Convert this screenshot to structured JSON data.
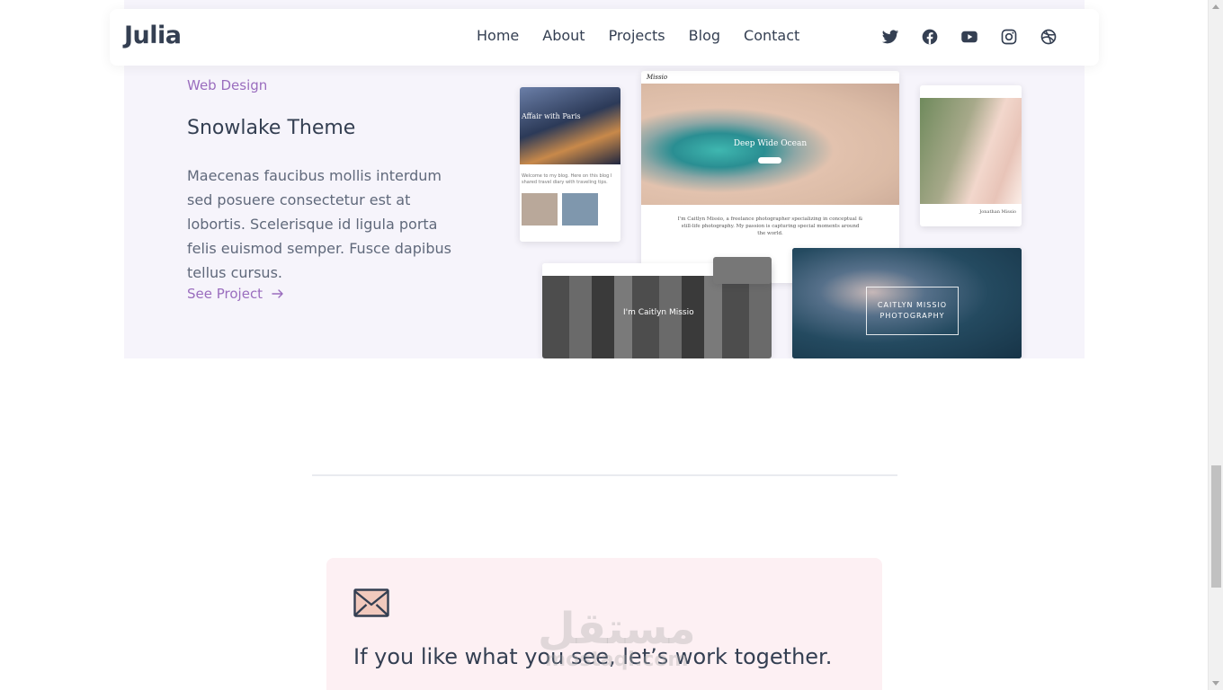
{
  "header": {
    "logo": "Julia",
    "nav": [
      "Home",
      "About",
      "Projects",
      "Blog",
      "Contact"
    ],
    "social": [
      "twitter-icon",
      "facebook-icon",
      "youtube-icon",
      "instagram-icon",
      "dribbble-icon"
    ]
  },
  "project": {
    "category": "Web Design",
    "title": "Snowlake Theme",
    "description": "Maecenas faucibus mollis interdum sed posuere consectetur est at lobortis. Scelerisque id ligula porta felis euismod semper. Fusce dapibus tellus cursus.",
    "link_label": "See Project",
    "mockups": {
      "m1_title": "Affair with Paris",
      "m1_text": "Welcome to my blog. Here on this blog I shared travel diary with traveling tips.",
      "m2_logo": "Missio",
      "m2_title": "Deep Wide Ocean",
      "m2_text": "I'm Caitlyn Missio, a freelance photographer specializing in conceptual & still-life photography. My passion is capturing special moments around the world.",
      "m3_text": "Jonathan Missio",
      "m4_title": "I'm Caitlyn Missio",
      "m5_title": "CAITLYN MISSIO PHOTOGRAPHY"
    }
  },
  "cta": {
    "icon": "mail-icon",
    "heading": "If you like what you see, let’s work together."
  },
  "colors": {
    "accent": "#9a6dbe",
    "project_bg": "#f6f4fb",
    "cta_bg": "#fdf0f3",
    "text": "#343f52"
  },
  "watermark": {
    "arabic": "مستقل",
    "latin": "mostaql.com"
  }
}
